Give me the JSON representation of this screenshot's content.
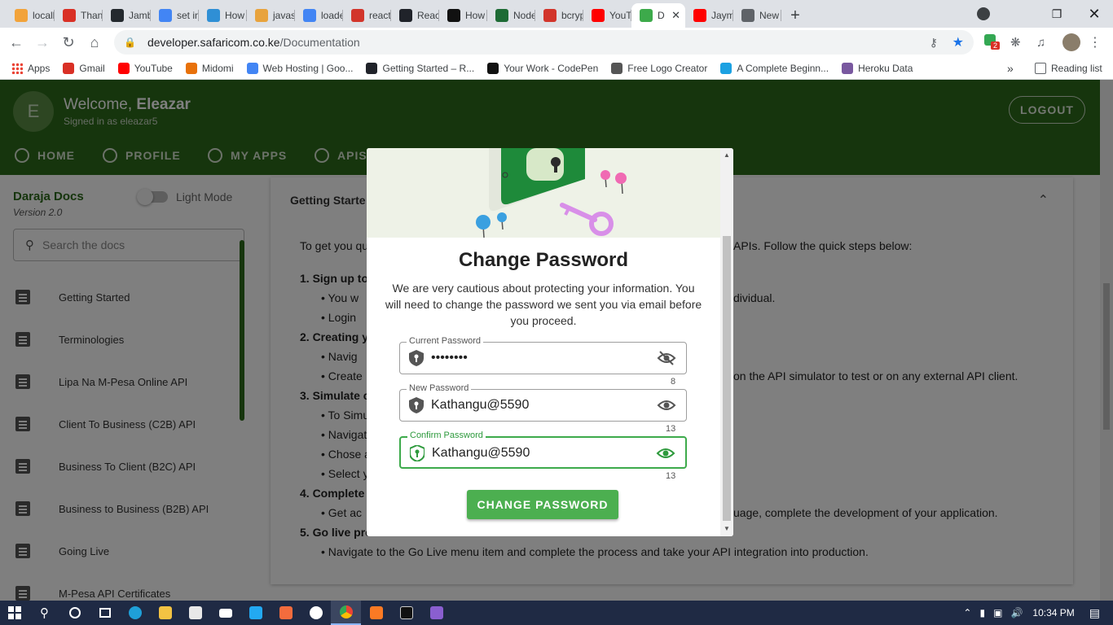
{
  "browser": {
    "tabs": [
      {
        "label": "locall",
        "color": "#f2a33a"
      },
      {
        "label": "Thanl",
        "color": "#d93025"
      },
      {
        "label": "Jamb",
        "color": "#24292e"
      },
      {
        "label": "set in",
        "color": "#4285f4"
      },
      {
        "label": "How",
        "color": "#2f8fd5"
      },
      {
        "label": "javas",
        "color": "#e8a33d"
      },
      {
        "label": "loade",
        "color": "#4285f4"
      },
      {
        "label": "react",
        "color": "#d2352b"
      },
      {
        "label": "React",
        "color": "#20232a"
      },
      {
        "label": "How",
        "color": "#111111"
      },
      {
        "label": "Node",
        "color": "#1e6b35"
      },
      {
        "label": "bcryp",
        "color": "#d2352b"
      },
      {
        "label": "YouT",
        "color": "#ff0000"
      },
      {
        "label": "D",
        "color": "#3daa4b"
      },
      {
        "label": "Jaym",
        "color": "#ff0000"
      },
      {
        "label": "New",
        "color": "#5f6368"
      }
    ],
    "new_tab_symbol": "+",
    "url_domain": "developer.safaricom.co.ke",
    "url_path": "/Documentation",
    "bookmarks": [
      {
        "label": "Apps",
        "color": "#e94235"
      },
      {
        "label": "Gmail",
        "color": "#d93025"
      },
      {
        "label": "YouTube",
        "color": "#ff0000"
      },
      {
        "label": "Midomi",
        "color": "#e8710a"
      },
      {
        "label": "Web Hosting | Goo...",
        "color": "#4285f4"
      },
      {
        "label": "Getting Started – R...",
        "color": "#20232a"
      },
      {
        "label": "Your Work - CodePen",
        "color": "#111111"
      },
      {
        "label": "Free Logo Creator",
        "color": "#555555"
      },
      {
        "label": "A Complete Beginn...",
        "color": "#1ba1e2"
      },
      {
        "label": "Heroku Data",
        "color": "#79589f"
      }
    ],
    "bookmarks_more": "»",
    "reading_list": "Reading list",
    "extension_badge": "2"
  },
  "header": {
    "avatar_letter": "E",
    "welcome_prefix": "Welcome, ",
    "welcome_name": "Eleazar",
    "signed_in": "Signed in as eleazar5",
    "logout": "LOGOUT",
    "nav": [
      "HOME",
      "PROFILE",
      "MY APPS",
      "APIS"
    ]
  },
  "sidebar": {
    "title": "Daraja Docs",
    "version": "Version 2.0",
    "mode_label": "Light Mode",
    "search_placeholder": "Search the docs",
    "items": [
      "Getting Started",
      "Terminologies",
      "Lipa Na M-Pesa Online API",
      "Client To Business (C2B) API",
      "Business To Client (B2C) API",
      "Business to Business (B2B) API",
      "Going Live",
      "M-Pesa API Certificates"
    ]
  },
  "content": {
    "heading": "Getting Starte",
    "lines": [
      {
        "text": "To get you qu",
        "bold": false
      },
      {
        "text": "1. Sign up to",
        "bold": true
      },
      {
        "text": "• You w",
        "bold": false
      },
      {
        "text": "• Login",
        "bold": false
      },
      {
        "text": "2. Creating y",
        "bold": true
      },
      {
        "text": "• Navig",
        "bold": false
      },
      {
        "text": "• Create",
        "bold": false
      },
      {
        "text": "3. Simulate c",
        "bold": true
      },
      {
        "text": "• To Simu",
        "bold": false
      },
      {
        "text": "• Navigat",
        "bold": false
      },
      {
        "text": "• Chose a",
        "bold": false
      },
      {
        "text": "• Select y",
        "bold": false
      },
      {
        "text": "4. Complete",
        "bold": true
      },
      {
        "text": "• Get ac",
        "bold": false
      },
      {
        "text": "5. Go live pro",
        "bold": true
      },
      {
        "text": "• Navigate to the Go Live menu item and complete the process and take your API integration into production.",
        "bold": false
      }
    ],
    "right_fragments": [
      "APIs. Follow the quick steps below:",
      "dividual.",
      "on the API simulator to test or on any external API client.",
      "uage, complete the development of your application."
    ]
  },
  "modal": {
    "title": "Change Password",
    "description": "We are very cautious about protecting your information. You will need to change the password we sent you via email before you proceed.",
    "fields": [
      {
        "label": "Current Password",
        "value": "••••••••",
        "counter": "8",
        "icon": "eye-off-icon"
      },
      {
        "label": "New Password",
        "value": "Kathangu@5590",
        "counter": "13",
        "icon": "eye-icon"
      },
      {
        "label": "Confirm Password",
        "value": "Kathangu@5590",
        "counter": "13",
        "icon": "eye-icon"
      }
    ],
    "button": "CHANGE PASSWORD",
    "accent_color": "#4caf50"
  },
  "taskbar": {
    "time": "10:34 PM"
  }
}
